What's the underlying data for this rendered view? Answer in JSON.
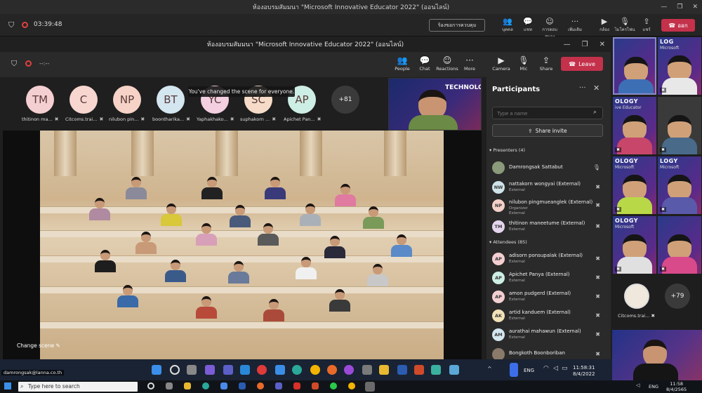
{
  "outer_window": {
    "title": "ห้องอบรมสัมมนา \"Microsoft Innovative Educator 2022\" (ออนไลน์)",
    "timer": "03:39:48",
    "controls_button": "ร้องขอการควบคุม",
    "tools": [
      {
        "icon": "people-icon",
        "label": "บุคคล"
      },
      {
        "icon": "chat-icon",
        "label": "แชท"
      },
      {
        "icon": "reactions-icon",
        "label": "การตอบสนอง"
      },
      {
        "icon": "more-icon",
        "label": "เพิ่มเติม"
      },
      {
        "icon": "camera-icon",
        "label": "กล้อง"
      },
      {
        "icon": "mic-off-icon",
        "label": "ไมโครโฟน"
      },
      {
        "icon": "share-icon",
        "label": "แชร์"
      }
    ],
    "leave_label": "ออก"
  },
  "inner_window": {
    "title": "ห้องอบรมสัมมนา \"Microsoft Innovative Educator 2022\" (ออนไลน์)",
    "timer": "--:--",
    "tools": [
      {
        "icon": "people-icon",
        "label": "People"
      },
      {
        "icon": "chat-icon",
        "label": "Chat"
      },
      {
        "icon": "reactions-icon",
        "label": "Reactions"
      },
      {
        "icon": "more-icon",
        "label": "More"
      },
      {
        "icon": "camera-icon",
        "label": "Camera"
      },
      {
        "icon": "mic-icon",
        "label": "Mic"
      },
      {
        "icon": "share-icon",
        "label": "Share"
      }
    ],
    "leave_label": "Leave",
    "toast": "You've changed the scene for everyone.",
    "change_scene_label": "Change scene",
    "avatars": [
      {
        "initials": "TM",
        "name": "thitinon ma...",
        "color": "#f4cfd2"
      },
      {
        "initials": "C",
        "name": "Citcoms.trai...",
        "color": "#f7d6d0"
      },
      {
        "initials": "NP",
        "name": "nilubon pin...",
        "color": "#f7d2c6"
      },
      {
        "initials": "BT",
        "name": "boontharika...",
        "color": "#d4e6ef"
      },
      {
        "initials": "YC",
        "name": "Yaphakhako...",
        "color": "#f3cfe0"
      },
      {
        "initials": "SC",
        "name": "suphakorn ...",
        "color": "#f6dcc8"
      },
      {
        "initials": "AP",
        "name": "Apichet Pan...",
        "color": "#cdeee4"
      }
    ],
    "more_count": "+81",
    "presenter_banner": "TECHNOLOGY"
  },
  "participants": {
    "title": "Participants",
    "search_placeholder": "Type a name",
    "share_invite": "Share invite",
    "presenters_heading": "Presenters (4)",
    "presenters": [
      {
        "initials": "",
        "name": "Damrongsak Sattabut",
        "sub": "",
        "color": "#8a9a7a"
      },
      {
        "initials": "NW",
        "name": "nattakorn wongyai (External)",
        "sub": "External",
        "color": "#cfe3e8"
      },
      {
        "initials": "NP",
        "name": "nilubon pingmueanglek (External)",
        "sub": "Organizer\nExternal",
        "color": "#f3d0c8"
      },
      {
        "initials": "TM",
        "name": "thitinon maneetume (External)",
        "sub": "External",
        "color": "#e5d4ee"
      }
    ],
    "attendees_heading": "Attendees (85)",
    "attendees": [
      {
        "initials": "AP",
        "name": "adisorn ponsupalak (External)",
        "sub": "External",
        "color": "#f4cfd2"
      },
      {
        "initials": "AP",
        "name": "Apichet Panya (External)",
        "sub": "External",
        "color": "#cdeee4"
      },
      {
        "initials": "AP",
        "name": "amon pudgerd (External)",
        "sub": "External",
        "color": "#f4cfd2"
      },
      {
        "initials": "AK",
        "name": "artid kanduem (External)",
        "sub": "External",
        "color": "#f2e2b8"
      },
      {
        "initials": "AM",
        "name": "aurathai mahawun (External)",
        "sub": "External",
        "color": "#d4e6ef"
      },
      {
        "initials": "",
        "name": "Bongkoth Boonboriban",
        "sub": "",
        "color": "#8a7a6a"
      }
    ]
  },
  "gallery": {
    "tiles": [
      {
        "lbl": "",
        "lbl2": "",
        "body": "#3d6fb5"
      },
      {
        "lbl": "LOG",
        "lbl2": "Microsoft",
        "body": "#e8e8e8"
      },
      {
        "lbl": "OLOGY",
        "lbl2": "ive Educator",
        "body": "#c7466a"
      },
      {
        "lbl": "",
        "lbl2": "",
        "body": "#4a6a8a"
      },
      {
        "lbl": "OLOGY",
        "lbl2": "Microsoft",
        "body": "#b8d848"
      },
      {
        "lbl": "LOGY",
        "lbl2": "Microsoft",
        "body": "#5a5aaa"
      },
      {
        "lbl": "OLOGY",
        "lbl2": "Microsoft",
        "body": "#e0e0e0"
      },
      {
        "lbl": "",
        "lbl2": "",
        "body": "#d84a8a"
      }
    ],
    "avatar_name": "Citcoms.trai...",
    "more_count": "+79"
  },
  "inner_taskbar": {
    "email": "damrongsak@lanna.co.th",
    "lang": "ENG",
    "time": "11:58:31",
    "date": "8/4/2022"
  },
  "outer_taskbar": {
    "search_placeholder": "Type here to search",
    "lang": "ENG",
    "time": "11:58",
    "date": "8/4/2565"
  }
}
